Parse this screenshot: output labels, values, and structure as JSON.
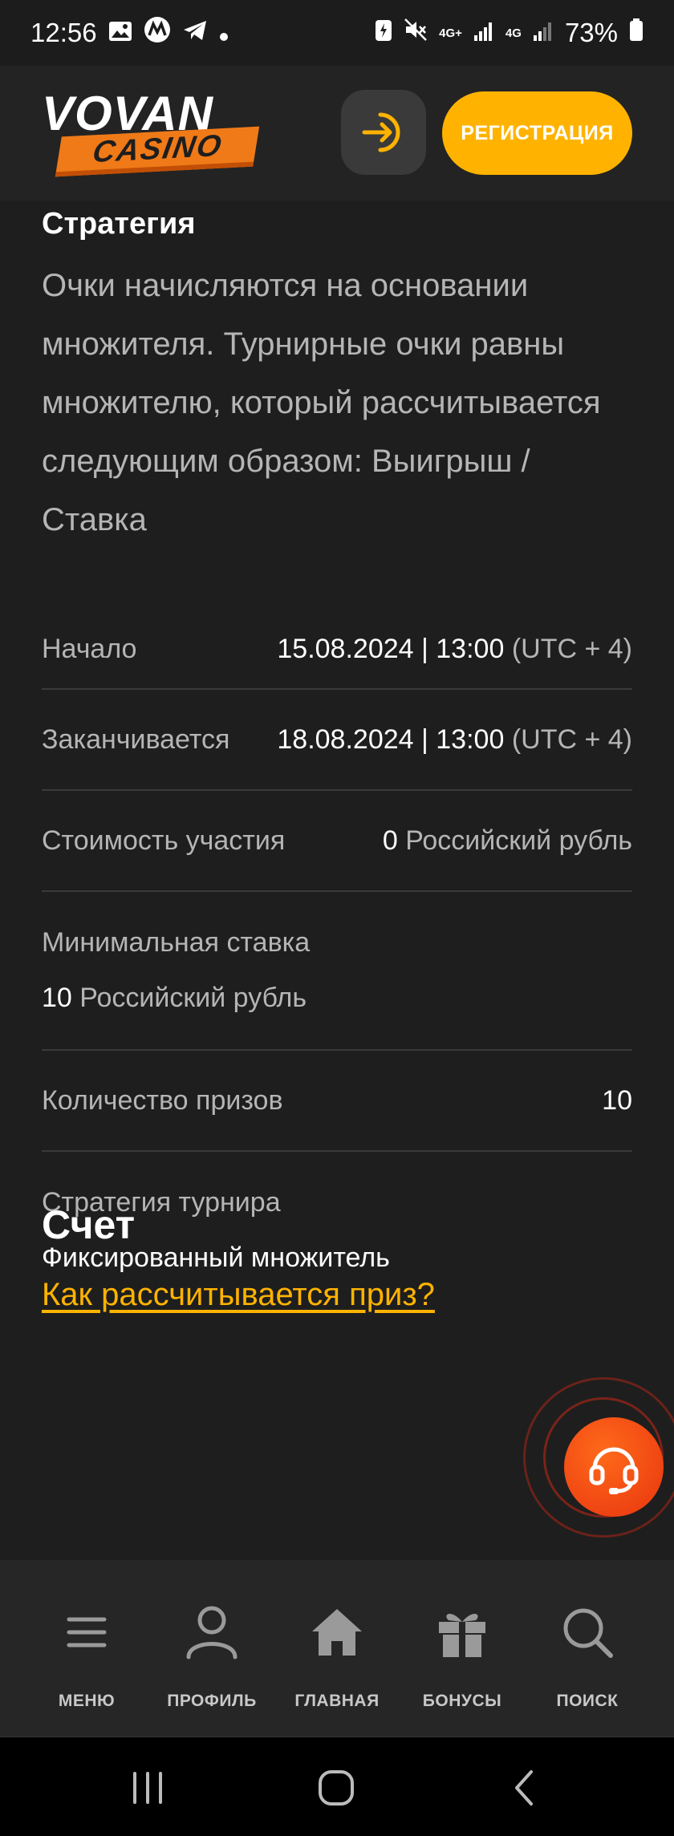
{
  "status_bar": {
    "time": "12:56",
    "net_label_1": "4G+",
    "net_label_2": "4G",
    "battery": "73%"
  },
  "header": {
    "logo_top": "VOVAN",
    "logo_bottom": "CASINO",
    "register_label": "РЕГИСТРАЦИЯ"
  },
  "strategy": {
    "title": "Стратегия",
    "text": "Очки начисляются на основании множителя. Турнирные очки равны множителю, который рассчитывается следующим образом: Выигрыш / Ставка"
  },
  "details": {
    "start": {
      "label": "Начало",
      "value": "15.08.2024 | 13:00",
      "tz": "(UTC + 4)"
    },
    "end": {
      "label": "Заканчивается",
      "value": "18.08.2024 | 13:00",
      "tz": "(UTC + 4)"
    },
    "cost": {
      "label": "Стоимость участия",
      "amount": "0",
      "currency": "Российский рубль"
    },
    "min_bet": {
      "label": "Минимальная ставка",
      "amount": "10",
      "currency": "Российский рубль"
    },
    "prizes": {
      "label": "Количество призов",
      "value": "10"
    },
    "tournament_strategy": {
      "label": "Стратегия турнира",
      "value": "Фиксированный множитель"
    }
  },
  "score": {
    "title": "Счет",
    "link": "Как рассчитывается приз?"
  },
  "bottom_nav": {
    "menu": "МЕНЮ",
    "profile": "ПРОФИЛЬ",
    "home": "ГЛАВНАЯ",
    "bonuses": "БОНУСЫ",
    "search": "ПОИСК"
  },
  "colors": {
    "accent": "#ffb300",
    "logo_orange": "#f07a18",
    "support": "#e8340f",
    "background": "#1e1e1e"
  }
}
